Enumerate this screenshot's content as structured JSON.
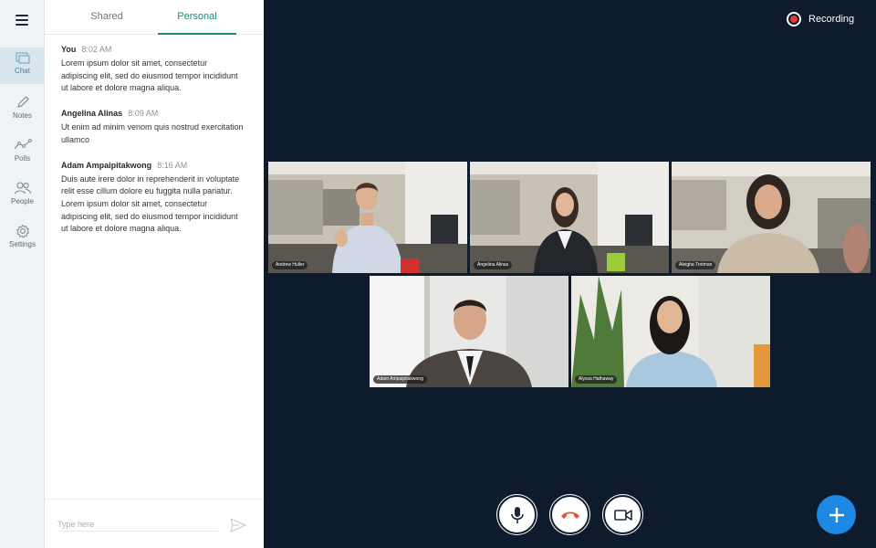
{
  "rail": {
    "items": [
      {
        "label": "Chat",
        "icon": "chat-icon",
        "active": true
      },
      {
        "label": "Notes",
        "icon": "pencil-icon",
        "active": false
      },
      {
        "label": "Polls",
        "icon": "polls-icon",
        "active": false
      },
      {
        "label": "People",
        "icon": "people-icon",
        "active": false
      },
      {
        "label": "Settings",
        "icon": "gear-icon",
        "active": false
      }
    ]
  },
  "chat": {
    "tabs": [
      {
        "label": "Shared",
        "active": false
      },
      {
        "label": "Personal",
        "active": true
      }
    ],
    "messages": [
      {
        "author": "You",
        "time": "8:02 AM",
        "text": "Lorem ipsum dolor sit amet, consectetur adipiscing elit, sed do eiusmod tempor incididunt ut labore et dolore magna aliqua."
      },
      {
        "author": "Angelina Alinas",
        "time": "8:09 AM",
        "text": "Ut enim ad minim venom quis nostrud exercitation ullamco"
      },
      {
        "author": "Adam Ampaipitakwong",
        "time": "8:16 AM",
        "text": "Duis aute irere dolor in reprehenderit in voluptate relit esse cillum dolore eu fuggita nulla pariatur. Lorem ipsum dolor sit amet, consectetur adipiscing elit, sed do eiusmod tempor incididunt ut labore et dolore magna aliqua."
      }
    ],
    "compose_placeholder": "Type here"
  },
  "stage": {
    "recording_label": "Recording",
    "participants": [
      {
        "name": "Andrew Huller",
        "speaking": false
      },
      {
        "name": "Angelina Alinas",
        "speaking": true
      },
      {
        "name": "Aleigha Trotman",
        "speaking": false
      },
      {
        "name": "Adam Ampaipitakwong",
        "speaking": false
      },
      {
        "name": "Alyssa Hathaway",
        "speaking": false
      }
    ]
  },
  "colors": {
    "accent": "#1f8a78",
    "stage_bg": "#0e1b2c",
    "speaking_border": "#5bc236",
    "recording_dot": "#e53935",
    "hangup": "#e5533d",
    "fab": "#1e88e5"
  }
}
